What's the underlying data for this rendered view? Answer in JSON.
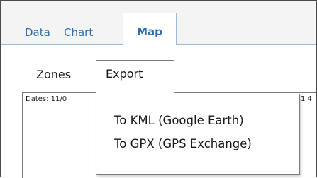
{
  "tabs": {
    "data": "Data",
    "chart": "Chart",
    "map": "Map"
  },
  "subtabs": {
    "zones": "Zones",
    "export": "Export"
  },
  "panel": {
    "dates_text": "Dates: 11/0",
    "dates_tail": "1 4"
  },
  "export_menu": {
    "items": [
      "To KML (Google Earth)",
      "To GPX (GPS Exchange)"
    ]
  },
  "colors": {
    "tab_text": "#2f6db0",
    "tab_border": "#9ebbd8",
    "menu_border": "#7c7c7c"
  }
}
